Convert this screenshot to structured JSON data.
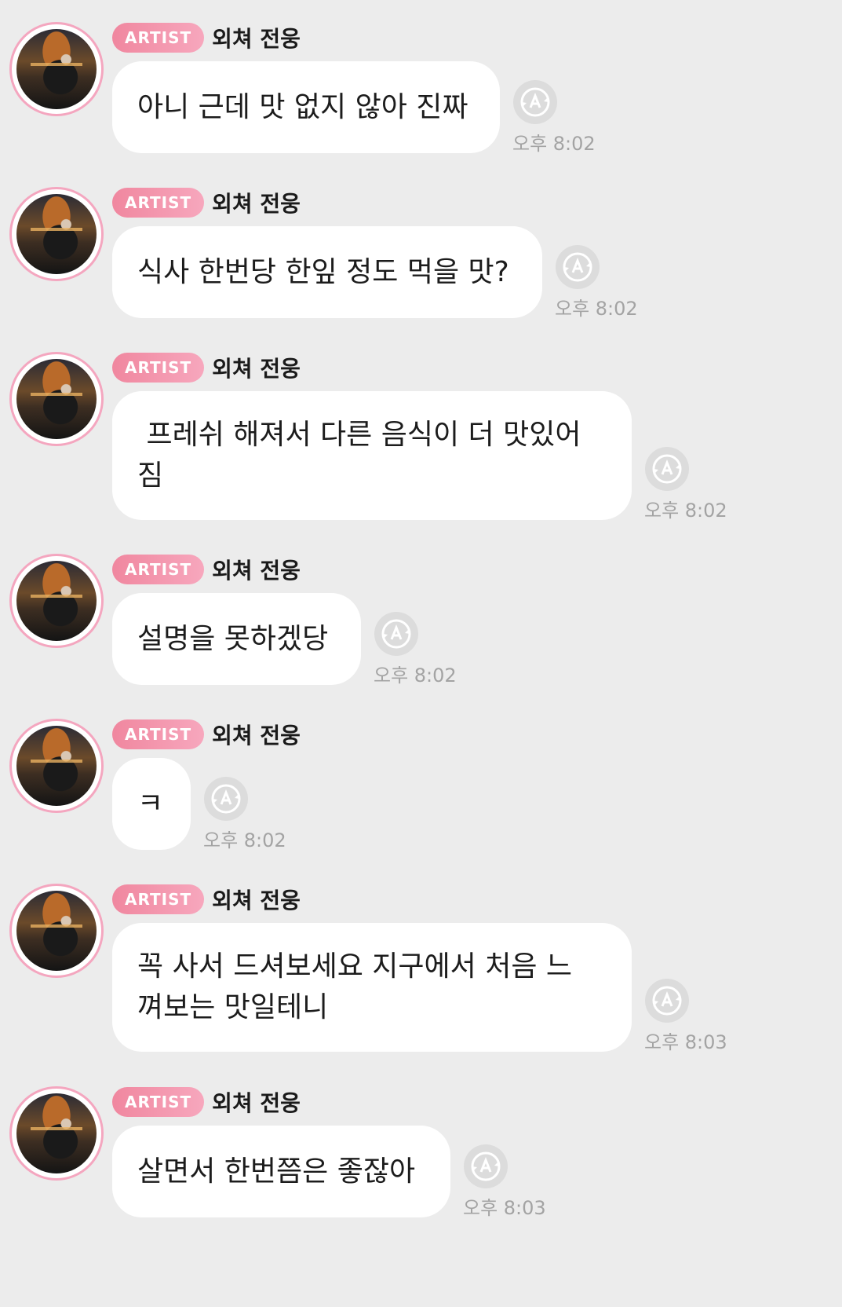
{
  "messages": [
    {
      "badge": "ARTIST",
      "sender": "외쳐 전웅",
      "text": "아니 근데 맛 없지 않아 진짜",
      "time": "오후 8:02"
    },
    {
      "badge": "ARTIST",
      "sender": "외쳐 전웅",
      "text": "식사 한번당 한잎 정도 먹을 맛?",
      "time": "오후 8:02"
    },
    {
      "badge": "ARTIST",
      "sender": "외쳐 전웅",
      "text": " 프레쉬 해져서 다른 음식이 더 맛있어\n짐",
      "time": "오후 8:02"
    },
    {
      "badge": "ARTIST",
      "sender": "외쳐 전웅",
      "text": "설명을 못하겠당",
      "time": "오후 8:02"
    },
    {
      "badge": "ARTIST",
      "sender": "외쳐 전웅",
      "text": "ㅋ",
      "time": "오후 8:02"
    },
    {
      "badge": "ARTIST",
      "sender": "외쳐 전웅",
      "text": "꼭 사서 드셔보세요 지구에서 처음 느\n껴보는 맛일테니",
      "time": "오후 8:03"
    },
    {
      "badge": "ARTIST",
      "sender": "외쳐 전웅",
      "text": "살면서 한번쯤은 좋잖아",
      "time": "오후 8:03"
    }
  ],
  "icons": {
    "translate": "translate-icon",
    "avatar": "avatar"
  },
  "colors": {
    "background": "#ececec",
    "badge": "#f0879f",
    "avatar_ring": "#f4a6bf",
    "bubble": "#ffffff",
    "time": "#a3a3a3"
  }
}
